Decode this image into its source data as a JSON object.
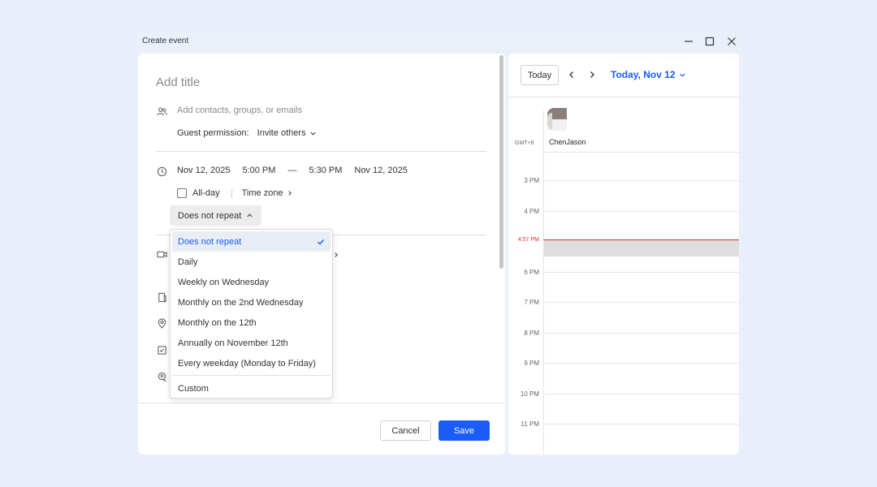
{
  "window": {
    "title": "Create event"
  },
  "form": {
    "title_placeholder": "Add title",
    "contacts_placeholder": "Add contacts, groups, or emails",
    "guest_permission_label": "Guest permission:",
    "guest_permission_value": "Invite others",
    "start_date": "Nov 12, 2025",
    "start_time": "5:00 PM",
    "dash": "—",
    "end_time": "5:30 PM",
    "end_date": "Nov 12, 2025",
    "allday_label": "All-day",
    "timezone_label": "Time zone",
    "repeat_value": "Does not repeat"
  },
  "repeat_menu": {
    "options": [
      "Does not repeat",
      "Daily",
      "Weekly on Wednesday",
      "Monthly on the 2nd Wednesday",
      "Monthly on the 12th",
      "Annually on November 12th",
      "Every weekday (Monday to Friday)"
    ],
    "selected_index": 0,
    "custom_label": "Custom"
  },
  "buttons": {
    "cancel": "Cancel",
    "save": "Save"
  },
  "calendar": {
    "today_button": "Today",
    "date_label": "Today, Nov 12",
    "timezone": "GMT+8",
    "user_name": "ChenJason",
    "hours": [
      "3 PM",
      "4 PM",
      "6 PM",
      "7 PM",
      "8 PM",
      "9 PM",
      "10 PM",
      "11 PM"
    ],
    "now_label": "4:57 PM"
  },
  "colors": {
    "accent": "#1a5cf5",
    "now_line": "#e0292e",
    "background": "#e8effb"
  }
}
